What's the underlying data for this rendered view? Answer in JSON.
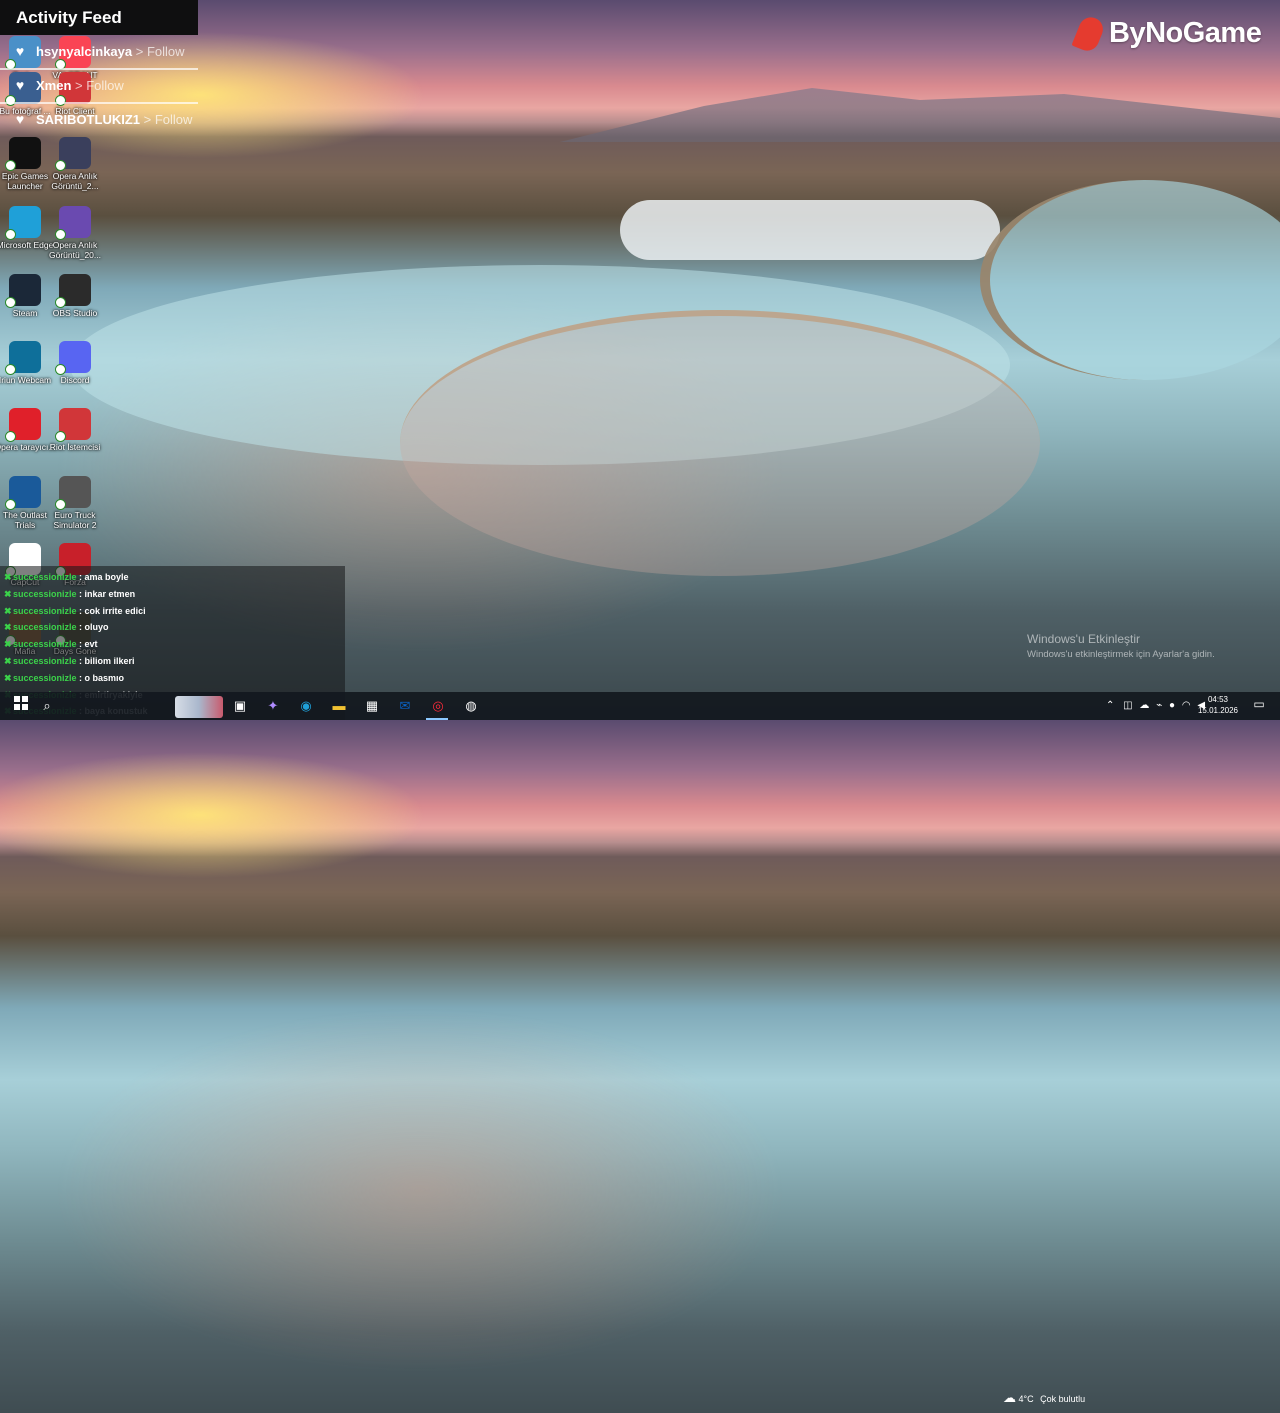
{
  "activity_feed": {
    "title": "Activity Feed",
    "items": [
      {
        "user": "hsynyalcinkaya",
        "action": "> Follow"
      },
      {
        "user": "Xmen",
        "action": "> Follow"
      },
      {
        "user": "SARIBOTLUKIZ1",
        "action": "> Follow"
      }
    ]
  },
  "logo": {
    "text": "ByNoGame",
    "accent": "#e53b2f"
  },
  "desktop_icons": [
    {
      "label": "Geri ...",
      "icon": "recycle-bin-icon",
      "color": "#4a90c8"
    },
    {
      "label": "VALORANT",
      "icon": "valorant-icon",
      "color": "#fa4454"
    },
    {
      "label": "Bu fotoğraf ...",
      "icon": "photo-icon",
      "color": "#3a5f90"
    },
    {
      "label": "Riot Client",
      "icon": "riot-client-icon",
      "color": "#d13639"
    },
    {
      "label": "Epic Games Launcher",
      "icon": "epic-games-icon",
      "color": "#111111"
    },
    {
      "label": "Opera Anlık Görüntü_2...",
      "icon": "opera-snapshot-icon",
      "color": "#3a3f5c"
    },
    {
      "label": "Microsoft Edge",
      "icon": "edge-icon",
      "color": "#1fa0d8"
    },
    {
      "label": "Opera Anlık Görüntü_20...",
      "icon": "opera-snapshot-icon",
      "color": "#6a4ab0"
    },
    {
      "label": "Steam",
      "icon": "steam-icon",
      "color": "#1b2838"
    },
    {
      "label": "OBS Studio",
      "icon": "obs-icon",
      "color": "#2b2b2b"
    },
    {
      "label": "Iriun Webcam",
      "icon": "webcam-icon",
      "color": "#0e6f9a"
    },
    {
      "label": "Discord",
      "icon": "discord-icon",
      "color": "#5865f2"
    },
    {
      "label": "Opera tarayıcı...",
      "icon": "opera-icon",
      "color": "#e0202a"
    },
    {
      "label": "Riot İstemcisi",
      "icon": "riot-client-icon",
      "color": "#d13639"
    },
    {
      "label": "The Outlast Trials",
      "icon": "outlast-icon",
      "color": "#1a5a9a"
    },
    {
      "label": "Euro Truck Simulator 2",
      "icon": "truck-icon",
      "color": "#555555"
    },
    {
      "label": "CapCut",
      "icon": "capcut-icon",
      "color": "#ffffff"
    },
    {
      "label": "Forza",
      "icon": "forza-icon",
      "color": "#c8202a"
    },
    {
      "label": "Mafia",
      "icon": "mafia-icon",
      "color": "#7a5a3a"
    },
    {
      "label": "Days Gone",
      "icon": "days-gone-icon",
      "color": "#4a4a3a"
    }
  ],
  "chat": [
    {
      "user": "successionizle",
      "message": "ama boyle"
    },
    {
      "user": "successionizle",
      "message": "inkar etmen"
    },
    {
      "user": "successionizle",
      "message": "cok irrite edici"
    },
    {
      "user": "successionizle",
      "message": "oluyo"
    },
    {
      "user": "successionizle",
      "message": "evt"
    },
    {
      "user": "successionizle",
      "message": "biliom ilkeri"
    },
    {
      "user": "successionizle",
      "message": "o basmıo"
    },
    {
      "user": "successionizle",
      "message": "emirtiryaklyle"
    },
    {
      "user": "successionizle",
      "message": "baya konustuk"
    }
  ],
  "watermark": {
    "title": "Windows'u Etkinleştir",
    "subtitle": "Windows'u etkinleştirmek için Ayarlar'a gidin."
  },
  "taskbar": {
    "apps": [
      "task-view-icon",
      "copilot-icon",
      "edge-icon",
      "file-explorer-icon",
      "store-icon",
      "outlook-icon",
      "opera-gx-icon",
      "obs-taskbar-icon"
    ],
    "weather": {
      "temp": "4°C",
      "condition": "Çok bulutlu"
    },
    "time": "04:53",
    "date": "15.01.2026"
  }
}
